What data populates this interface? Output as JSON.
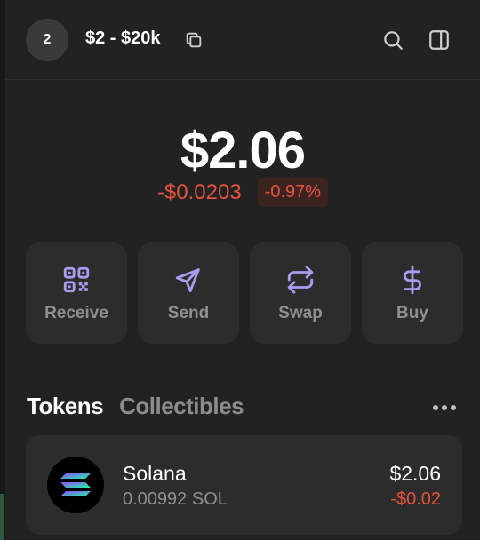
{
  "header": {
    "account_badge": "2",
    "account_name": "$2 - $20k"
  },
  "portfolio": {
    "balance": "$2.06",
    "change_value": "-$0.0203",
    "change_percent": "-0.97%"
  },
  "actions": [
    {
      "label": "Receive",
      "icon": "qr-code-icon"
    },
    {
      "label": "Send",
      "icon": "send-icon"
    },
    {
      "label": "Swap",
      "icon": "swap-icon"
    },
    {
      "label": "Buy",
      "icon": "dollar-icon"
    }
  ],
  "tabs": {
    "tokens": "Tokens",
    "collectibles": "Collectibles"
  },
  "tokens": [
    {
      "name": "Solana",
      "amount": "0.00992 SOL",
      "value": "$2.06",
      "change": "-$0.02"
    }
  ],
  "colors": {
    "accent": "#a99cf0",
    "negative": "#e5533d",
    "card": "#2c2c2c",
    "background": "#222222"
  }
}
